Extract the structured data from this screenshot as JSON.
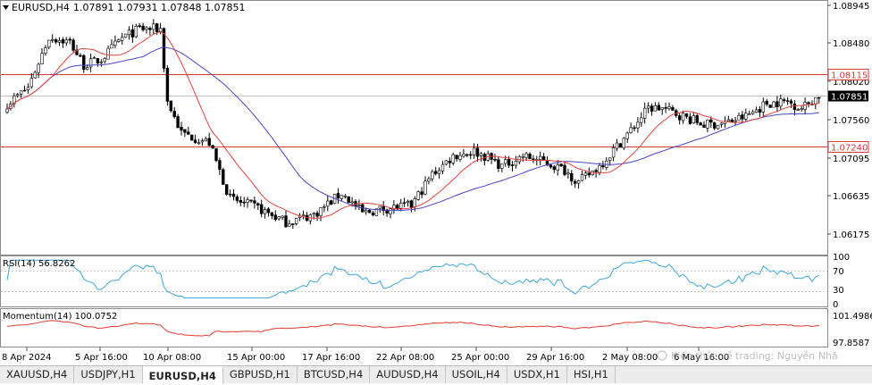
{
  "title": {
    "symbol": "EURUSD,H4",
    "ohlc": "1.07891 1.07931 1.07848 1.07851"
  },
  "watermark": "Kiến thức về trading: Nguyễn Nhã",
  "colors": {
    "bull_body": "#ffffff",
    "bear_body": "#000000",
    "ma_fast": "#e8413a",
    "ma_slow": "#4747c8",
    "level_line": "#d63a3a",
    "rsi_line": "#3ea7e0",
    "momentum_line": "#e23a2f",
    "grid_dotted": "#c8c8c8"
  },
  "main_price_axis": {
    "labels": [
      "1.08945",
      "1.08480",
      "1.08020",
      "1.07560",
      "1.07095",
      "1.06635",
      "1.06175"
    ]
  },
  "levels": [
    {
      "label": "1.08115",
      "value": 1.08115
    },
    {
      "label": "1.07240",
      "value": 1.0724
    }
  ],
  "current_price": {
    "label": "1.07851",
    "value": 1.07851
  },
  "rsi": {
    "title": "RSI(14) 56.8262",
    "axis_labels": [
      "100",
      "70",
      "30",
      "0"
    ]
  },
  "momentum": {
    "title": "Momentum(14) 100.0752",
    "axis_labels": [
      "101.4986",
      "97.8587"
    ]
  },
  "time_axis": {
    "labels": [
      "8 Apr 2024",
      "5 Apr 16:00",
      "10 Apr 08:00",
      "15 Apr 00:00",
      "17 Apr 16:00",
      "22 Apr 08:00",
      "25 Apr 00:00",
      "29 Apr 16:00",
      "2 May 08:00",
      "6 May 16:00"
    ]
  },
  "tabs": [
    {
      "label": "XAUUSD,H4",
      "active": false
    },
    {
      "label": "USDJPY,H1",
      "active": false
    },
    {
      "label": "EURUSD,H4",
      "active": true
    },
    {
      "label": "GBPUSD,H1",
      "active": false
    },
    {
      "label": "BTCUSD,H4",
      "active": false
    },
    {
      "label": "AUDUSD,H4",
      "active": false
    },
    {
      "label": "USOIL,H4",
      "active": false
    },
    {
      "label": "USDX,H1",
      "active": false
    },
    {
      "label": "HSI,H1",
      "active": false
    }
  ]
}
